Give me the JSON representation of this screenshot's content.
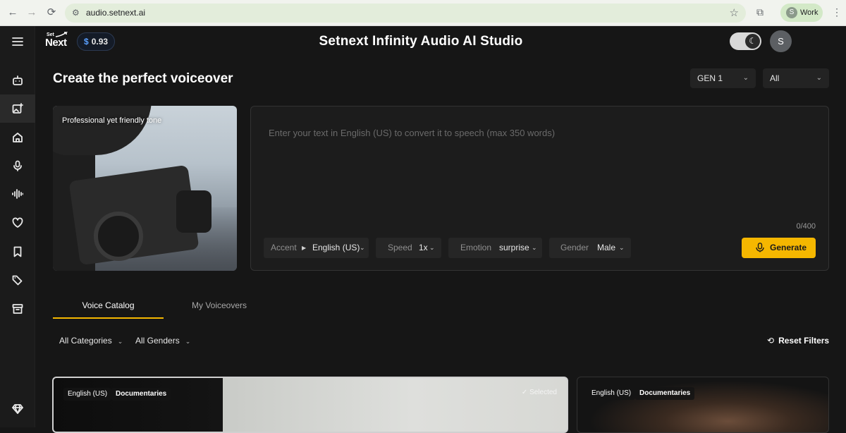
{
  "browser": {
    "url": "audio.setnext.ai",
    "profile_initial": "S",
    "profile_name": "Work"
  },
  "header": {
    "logo_top": "Set",
    "logo_main": "Next",
    "balance_currency": "$",
    "balance_value": "0.93",
    "title": "Setnext Infinity Audio AI Studio",
    "user_initial": "S"
  },
  "page": {
    "title": "Create the perfect voiceover",
    "generation_select": "GEN 1",
    "filter_select": "All"
  },
  "preview": {
    "caption": "Professional yet friendly tone"
  },
  "editor": {
    "placeholder": "Enter your text in English (US) to convert it to speech (max 350 words)",
    "counter": "0/400",
    "accent_label": "Accent",
    "accent_value": "English (US)",
    "speed_label": "Speed",
    "speed_value": "1x",
    "emotion_label": "Emotion",
    "emotion_value": "surprise",
    "gender_label": "Gender",
    "gender_value": "Male",
    "generate_label": "Generate"
  },
  "tabs": [
    {
      "label": "Voice Catalog",
      "active": true
    },
    {
      "label": "My Voiceovers",
      "active": false
    }
  ],
  "filters": {
    "categories": "All Categories",
    "genders": "All Genders",
    "reset": "Reset Filters"
  },
  "voice_cards": [
    {
      "language": "English (US)",
      "category": "Documentaries",
      "status": "Selected"
    },
    {
      "language": "English (US)",
      "category": "Documentaries"
    }
  ],
  "colors": {
    "accent": "#f5b700",
    "background": "#161616"
  }
}
